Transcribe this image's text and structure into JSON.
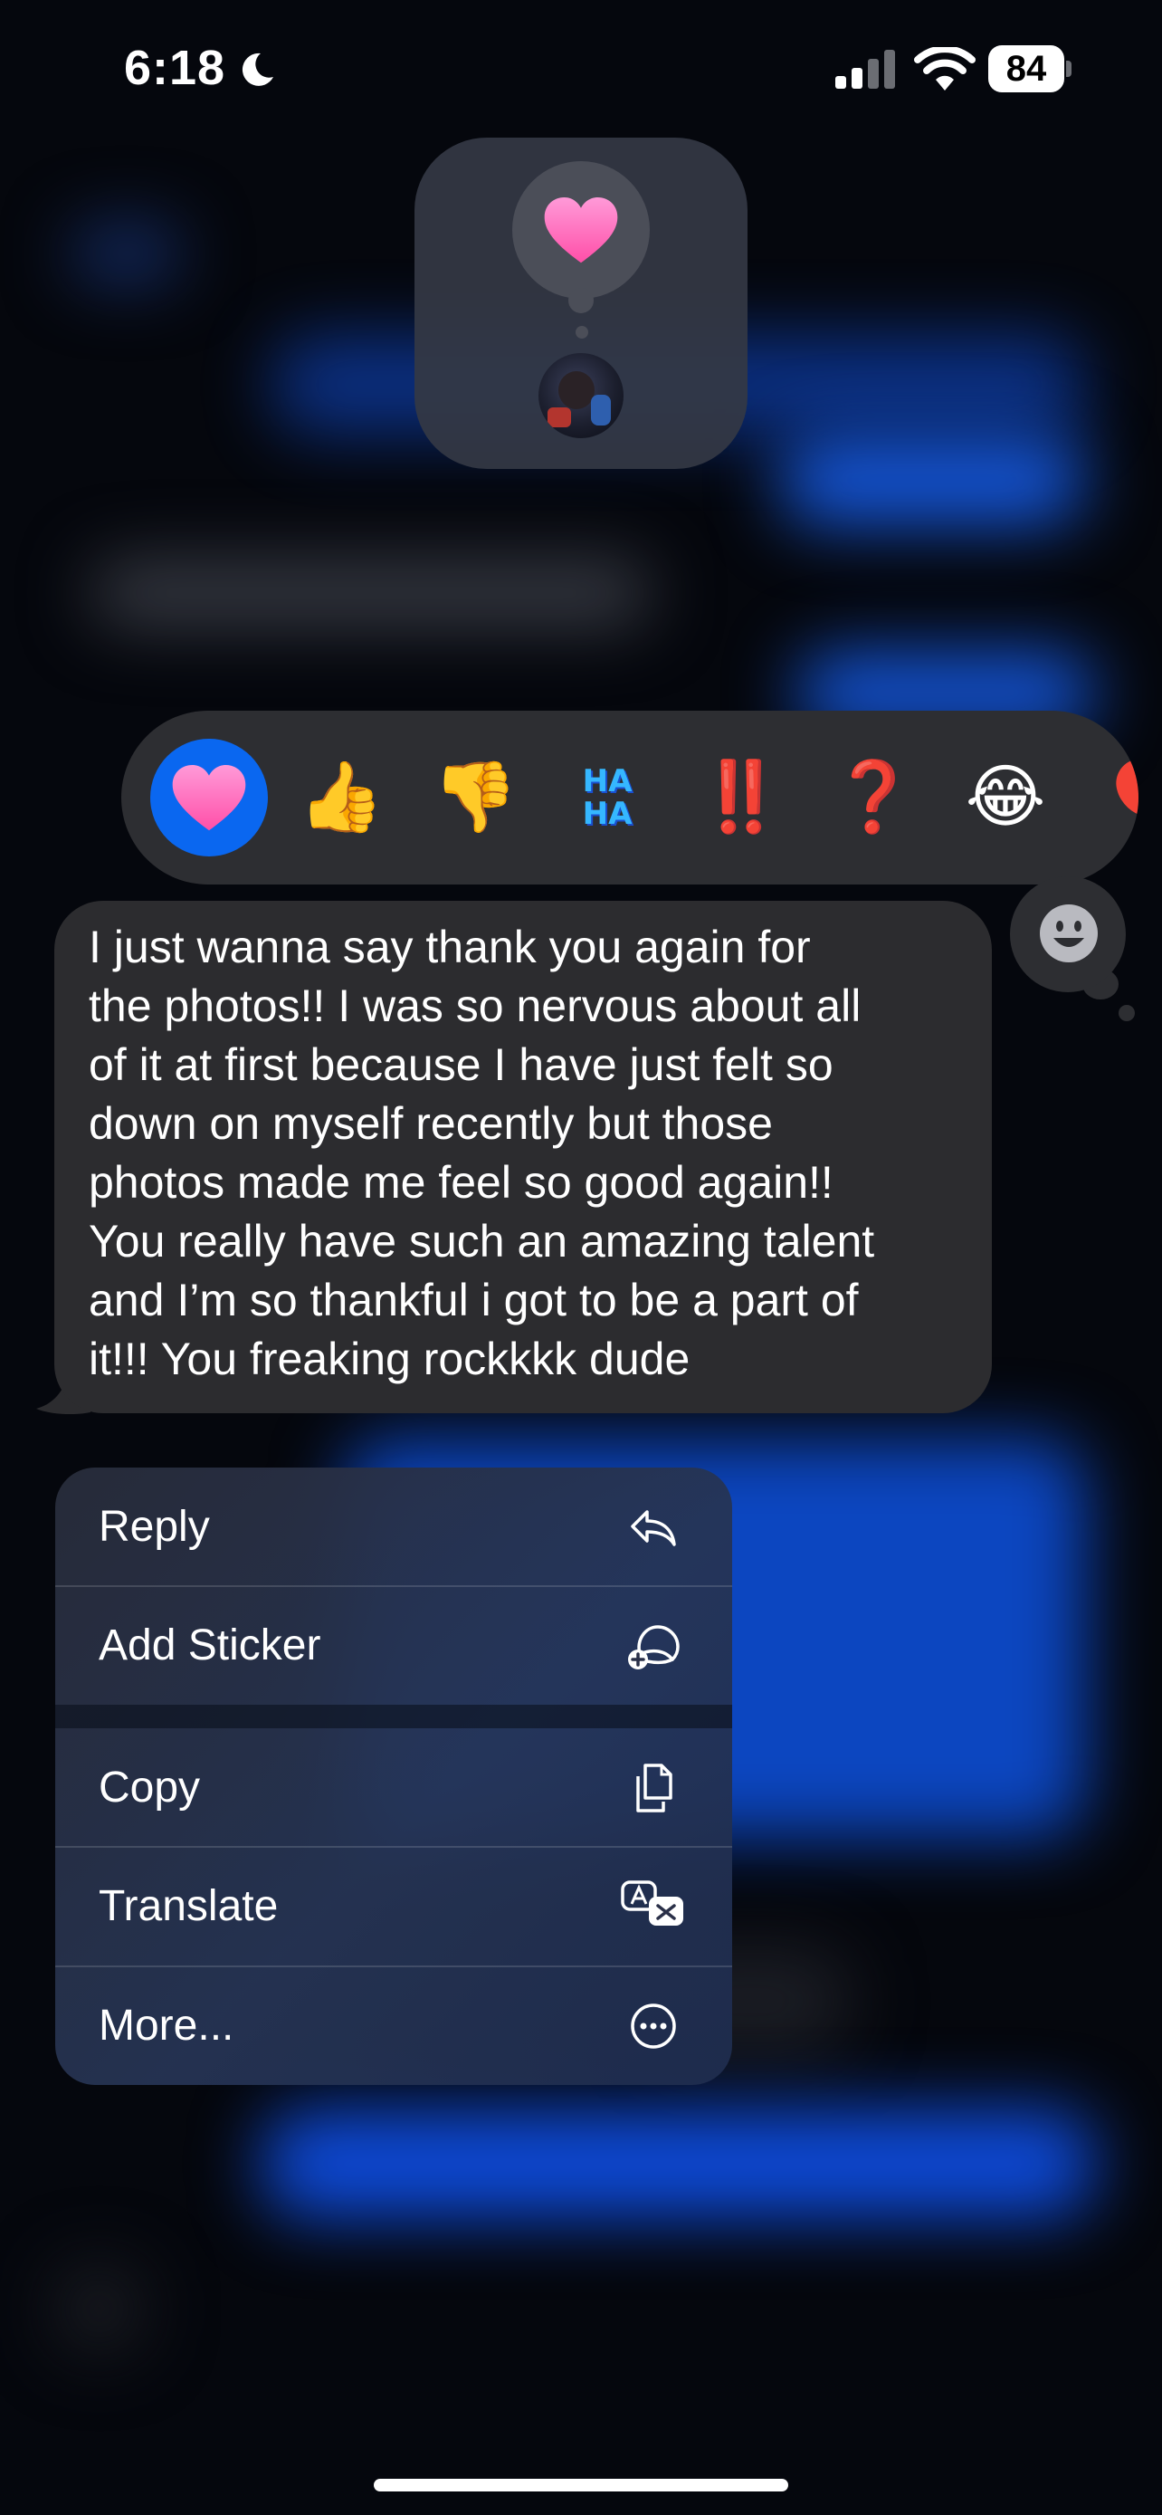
{
  "status_bar": {
    "time": "6:18",
    "battery_level": "84"
  },
  "reaction_summary": {
    "reaction": "heart"
  },
  "tapback_bar": {
    "items": [
      {
        "name": "heart",
        "glyph": "",
        "selected": true
      },
      {
        "name": "thumbs-up",
        "glyph": "👍"
      },
      {
        "name": "thumbs-down",
        "glyph": "👎"
      },
      {
        "name": "haha",
        "glyph": "",
        "text_top": "HA",
        "text_bottom": "HA"
      },
      {
        "name": "exclamation",
        "glyph": "‼️"
      },
      {
        "name": "question",
        "glyph": "❓"
      },
      {
        "name": "laughing",
        "glyph": "😂"
      },
      {
        "name": "balloon",
        "glyph": "🎈"
      }
    ]
  },
  "message": {
    "text": "I just wanna say thank you again for\nthe photos!! I was so nervous about all\nof it at first because I have just felt so\ndown on myself recently but those\nphotos made me feel so good again!!\nYou really have such an amazing talent\nand I’m so thankful i got to be a part of\nit!!! You freaking rockkkk dude"
  },
  "context_menu": {
    "items": [
      {
        "label": "Reply",
        "icon": "reply-arrow-icon"
      },
      {
        "label": "Add Sticker",
        "icon": "add-sticker-icon"
      },
      {
        "label": "Copy",
        "icon": "copy-icon"
      },
      {
        "label": "Translate",
        "icon": "translate-icon"
      },
      {
        "label": "More...",
        "icon": "more-ellipsis-icon"
      }
    ]
  },
  "colors": {
    "accent": "#0a67f0",
    "bubble": "#2c2c2f",
    "background": "#05070d"
  }
}
